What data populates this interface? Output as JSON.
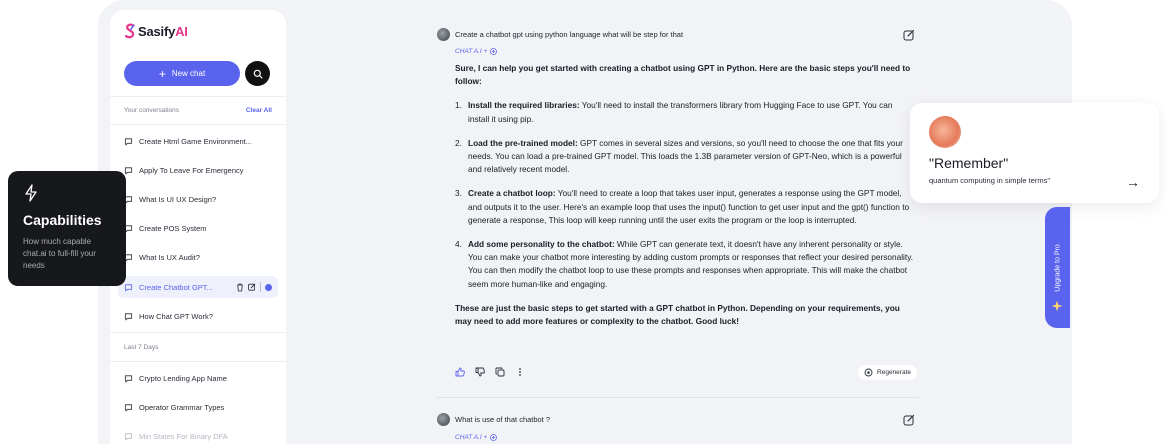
{
  "brand": {
    "name": "Sasify",
    "suffix": "AI",
    "accent": "#5a63ee",
    "pink": "#e5358c"
  },
  "sidebar": {
    "new_chat_label": "New chat",
    "conversations_header": "Your conversations",
    "clear_all_label": "Clear All",
    "conversations": [
      {
        "label": "Create Html Game Environment..."
      },
      {
        "label": "Apply To Leave For Emergency"
      },
      {
        "label": "What Is UI UX Design?"
      },
      {
        "label": "Create POS System"
      },
      {
        "label": "What Is UX Audit?"
      },
      {
        "label": "Create Chatbot GPT..."
      },
      {
        "label": "How Chat GPT Work?"
      }
    ],
    "last7_header": "Last 7 Days",
    "last7": [
      {
        "label": "Crypto Lending App Name"
      },
      {
        "label": "Operator Grammar Types"
      },
      {
        "label": "Min States For Binary DFA"
      }
    ]
  },
  "capabilities": {
    "title": "Capabilities",
    "description": "How much capable chat.ai to full-fill your needs"
  },
  "chat": {
    "question1": "Create a chatbot gpt using python language what will be step for that",
    "model_label": "CHAT A.I +",
    "answer_intro": "Sure, I can help you get started with creating a chatbot using GPT in Python. Here are the basic steps you'll need to follow:",
    "steps": [
      {
        "num": "1.",
        "title": "Install the required libraries:",
        "text": " You'll need to install the transformers library from Hugging Face to use GPT. You can install it using pip."
      },
      {
        "num": "2.",
        "title": "Load the pre-trained model:",
        "text": " GPT comes in several sizes and versions, so you'll need to choose the one that fits your needs. You can load a pre-trained GPT model. This loads the 1.3B parameter version of GPT-Neo, which is a powerful and relatively recent model."
      },
      {
        "num": "3.",
        "title": "Create a chatbot loop:",
        "text": " You'll need to create a loop that takes user input, generates a response using the GPT model, and outputs it to the user. Here's an example loop that uses the input() function to get user input and the gpt() function to generate a response, This loop will keep running until the user exits the program or the loop is interrupted."
      },
      {
        "num": "4.",
        "title": "Add some personality to the chatbot:",
        "text": " While GPT can generate text, it doesn't have any inherent personality or style. You can make your chatbot more interesting by adding custom prompts or responses that reflect your desired personality. You can then modify the chatbot loop to use these prompts and responses when appropriate. This will make the chatbot seem more human-like and engaging."
      }
    ],
    "answer_outro": "These are just the basic steps to get started with a GPT chatbot in Python. Depending on your requirements, you may need to add more features or complexity to the chatbot. Good luck!",
    "regenerate_label": "Regenerate",
    "question2": "What is use of that chatbot ?",
    "model_label2": "CHAT A.I +"
  },
  "remember_card": {
    "title": "\"Remember\"",
    "subtitle": "quantum computing in simple terms\""
  },
  "upgrade": {
    "label": "Upgrade to Pro"
  }
}
